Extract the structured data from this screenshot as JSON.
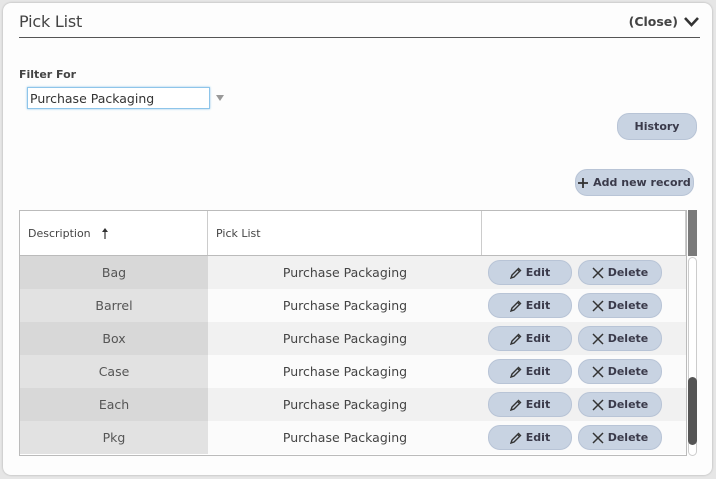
{
  "panel": {
    "title": "Pick List",
    "close_label": "(Close)"
  },
  "filter": {
    "label": "Filter For",
    "value": "Purchase Packaging"
  },
  "buttons": {
    "history": "History",
    "add_new": "Add new record"
  },
  "grid": {
    "columns": [
      "Description",
      "Pick List",
      ""
    ],
    "sort": "ascending",
    "rows": [
      {
        "description": "Bag",
        "pick_list": "Purchase Packaging"
      },
      {
        "description": "Barrel",
        "pick_list": "Purchase Packaging"
      },
      {
        "description": "Box",
        "pick_list": "Purchase Packaging"
      },
      {
        "description": "Case",
        "pick_list": "Purchase Packaging"
      },
      {
        "description": "Each",
        "pick_list": "Purchase Packaging"
      },
      {
        "description": "Pkg",
        "pick_list": "Purchase Packaging"
      }
    ],
    "edit_label": "Edit",
    "delete_label": "Delete"
  },
  "colors": {
    "button_bg": "#c8d3e2",
    "input_focus": "#8ec5ea"
  }
}
